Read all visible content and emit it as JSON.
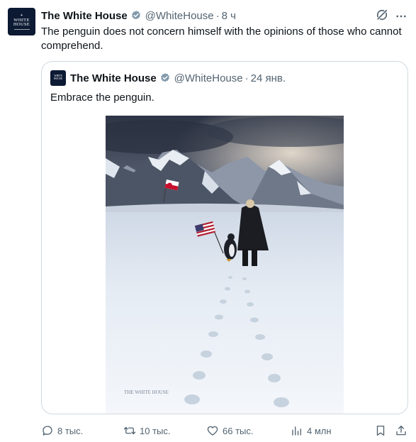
{
  "tweet": {
    "author_name": "The White House",
    "author_handle": "@WhiteHouse",
    "separator": "·",
    "time": "8 ч",
    "text": "The penguin does not concern himself with the opinions of those who cannot comprehend.",
    "avatar_text": [
      "WHITE",
      "HOUSE"
    ]
  },
  "quoted": {
    "author_name": "The White House",
    "author_handle": "@WhiteHouse",
    "separator": "·",
    "time": "24 янв.",
    "text": "Embrace the penguin.",
    "avatar_text": [
      "WHITE",
      "HOUSE"
    ],
    "media": {
      "watermark": "THE WHITE HOUSE"
    }
  },
  "actions": {
    "replies": "8 тыс.",
    "reposts": "10 тыс.",
    "likes": "66 тыс.",
    "views": "4 млн"
  },
  "colors": {
    "text": "#0f1419",
    "muted": "#536471",
    "border": "#cfd9de",
    "verified_gray": "#829aab",
    "avatar_bg": "#0c1a33"
  },
  "icons": [
    "verified-badge-icon",
    "grok-icon",
    "more-icon",
    "reply-icon",
    "repost-icon",
    "like-icon",
    "views-icon",
    "bookmark-icon",
    "share-icon"
  ]
}
